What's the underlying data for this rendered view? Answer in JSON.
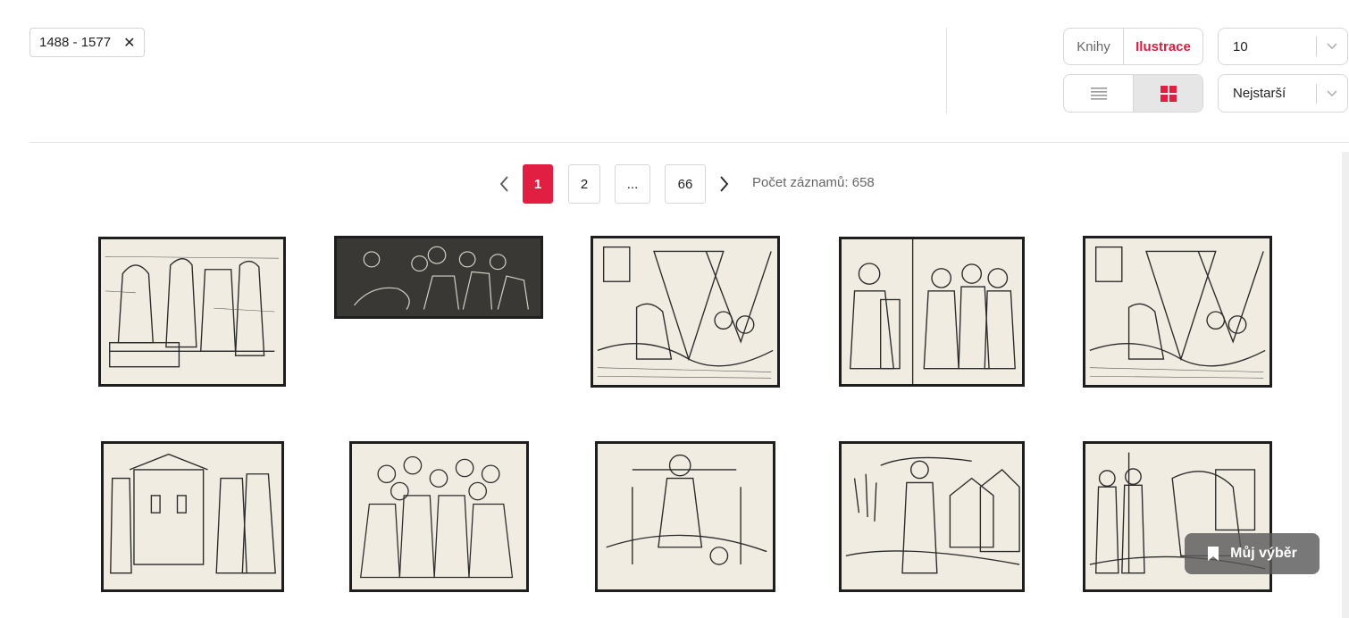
{
  "filters": {
    "year_range": "1488 - 1577",
    "remove_icon": "close-icon"
  },
  "type_toggle": {
    "books": "Knihy",
    "illustrations": "Ilustrace",
    "active": "illustrations"
  },
  "view_toggle": {
    "list_icon": "list-view-icon",
    "grid_icon": "grid-view-icon",
    "active": "grid"
  },
  "page_size": {
    "value": "10"
  },
  "sort": {
    "value": "Nejstarší"
  },
  "pagination": {
    "pages": [
      "1",
      "2",
      "...",
      "66"
    ],
    "current": "1",
    "total_label": "Počet záznamů: 658"
  },
  "results": {
    "count_shown": 10
  },
  "selection_button": {
    "label": "Můj výběr",
    "icon": "bookmark-icon"
  },
  "colors": {
    "accent": "#e11f42",
    "accent_text": "#d81e3f"
  }
}
